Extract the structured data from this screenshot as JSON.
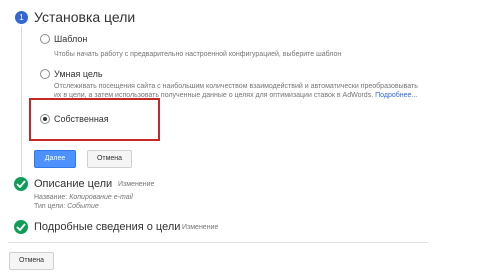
{
  "step1": {
    "number": "1",
    "title": "Установка цели",
    "options": [
      {
        "label": "Шаблон",
        "description": "Чтобы начать работу с предварительно настроенной конфигурацией, выберите шаблон",
        "checked": false
      },
      {
        "label": "Умная цель",
        "description_line1": "Отслеживать посещения сайта с наибольшим количеством взаимодействий и автоматически преобразовывать",
        "description_line2": "их в цели, а затем использовать полученные данные о целях для оптимизации ставок в AdWords.",
        "more_link": "Подробнее...",
        "checked": false
      },
      {
        "label": "Собственная",
        "checked": true
      }
    ],
    "next_button": "Далее",
    "cancel_button": "Отмена"
  },
  "step2": {
    "title": "Описание цели",
    "edit_link": "Изменение",
    "name_label": "Название:",
    "name_value": "Копирование e-mail",
    "type_label": "Тип цели:",
    "type_value": "Событие"
  },
  "step3": {
    "title": "Подробные сведения о цели",
    "edit_link": "Изменение"
  },
  "footer": {
    "cancel_button": "Отмена"
  },
  "colors": {
    "accent": "#3367d6",
    "primary_button": "#4d90fe",
    "success": "#0f9d58",
    "highlight": "#c62828"
  }
}
